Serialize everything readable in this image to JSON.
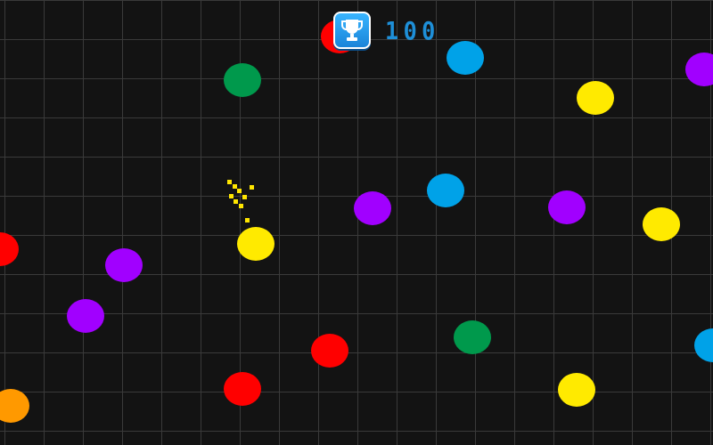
{
  "hud": {
    "score": "100",
    "trophy_icon": "trophy-icon"
  },
  "palette": {
    "red": "#ff0000",
    "green": "#00994c",
    "blue": "#00a2e8",
    "purple": "#a100ff",
    "yellow": "#ffea00",
    "orange": "#ff9900",
    "background": "#131313",
    "grid": "#3a3a3a"
  },
  "player": {
    "color": "yellow",
    "trail_color": "#ffe600"
  },
  "dots": [
    {
      "color": "red"
    },
    {
      "color": "green"
    },
    {
      "color": "blue"
    },
    {
      "color": "purple"
    },
    {
      "color": "yellow"
    },
    {
      "color": "blue"
    },
    {
      "color": "purple"
    },
    {
      "color": "purple"
    },
    {
      "color": "yellow"
    },
    {
      "color": "red"
    },
    {
      "color": "purple"
    },
    {
      "color": "purple"
    },
    {
      "color": "green"
    },
    {
      "color": "red"
    },
    {
      "color": "blue"
    },
    {
      "color": "orange"
    },
    {
      "color": "red"
    },
    {
      "color": "yellow"
    }
  ]
}
